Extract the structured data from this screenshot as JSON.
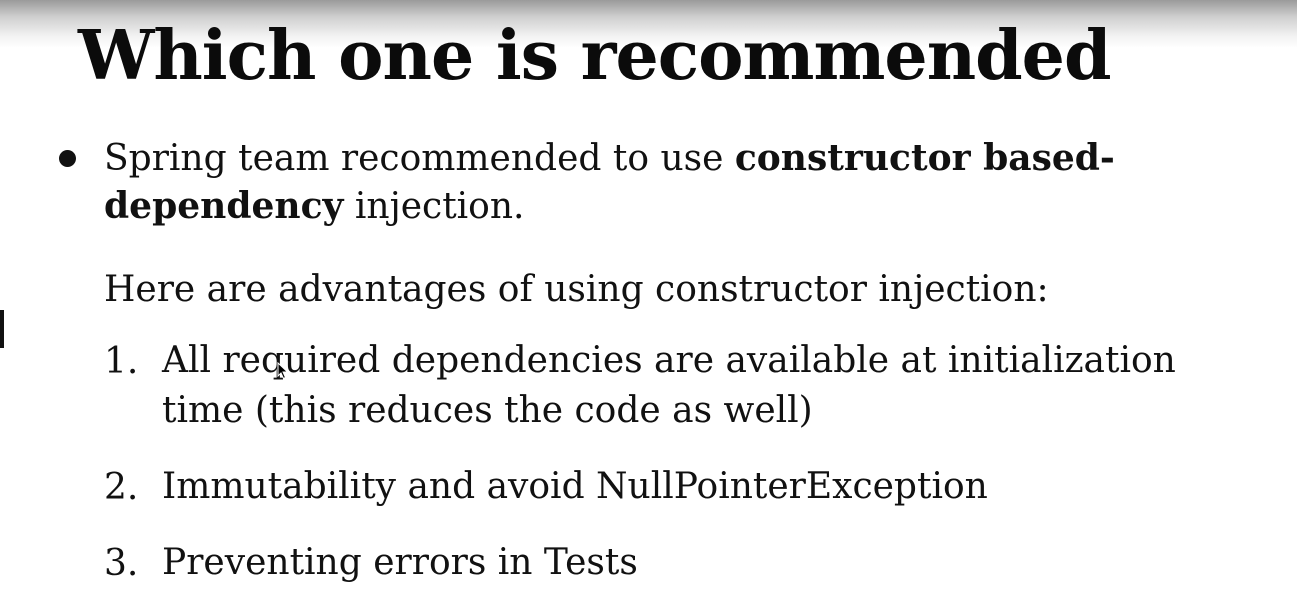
{
  "slide": {
    "title": "Which one is recommended",
    "recommendation": {
      "line1_pre": "Spring team recommended to use ",
      "line1_bold": "constructor based-",
      "line2_bold": "dependency",
      "line2_post": " injection."
    },
    "intro": "Here are advantages of using constructor injection:",
    "advantages": [
      {
        "number": "1.",
        "text": "All required dependencies are available at initialization time (this reduces the code as well)"
      },
      {
        "number": "2.",
        "text": "Immutability and avoid NullPointerException"
      },
      {
        "number": "3.",
        "text": "Preventing errors in Tests"
      }
    ]
  },
  "icons": {
    "cursor": "mouse-pointer-icon",
    "bullet": "bullet-dot-icon"
  }
}
